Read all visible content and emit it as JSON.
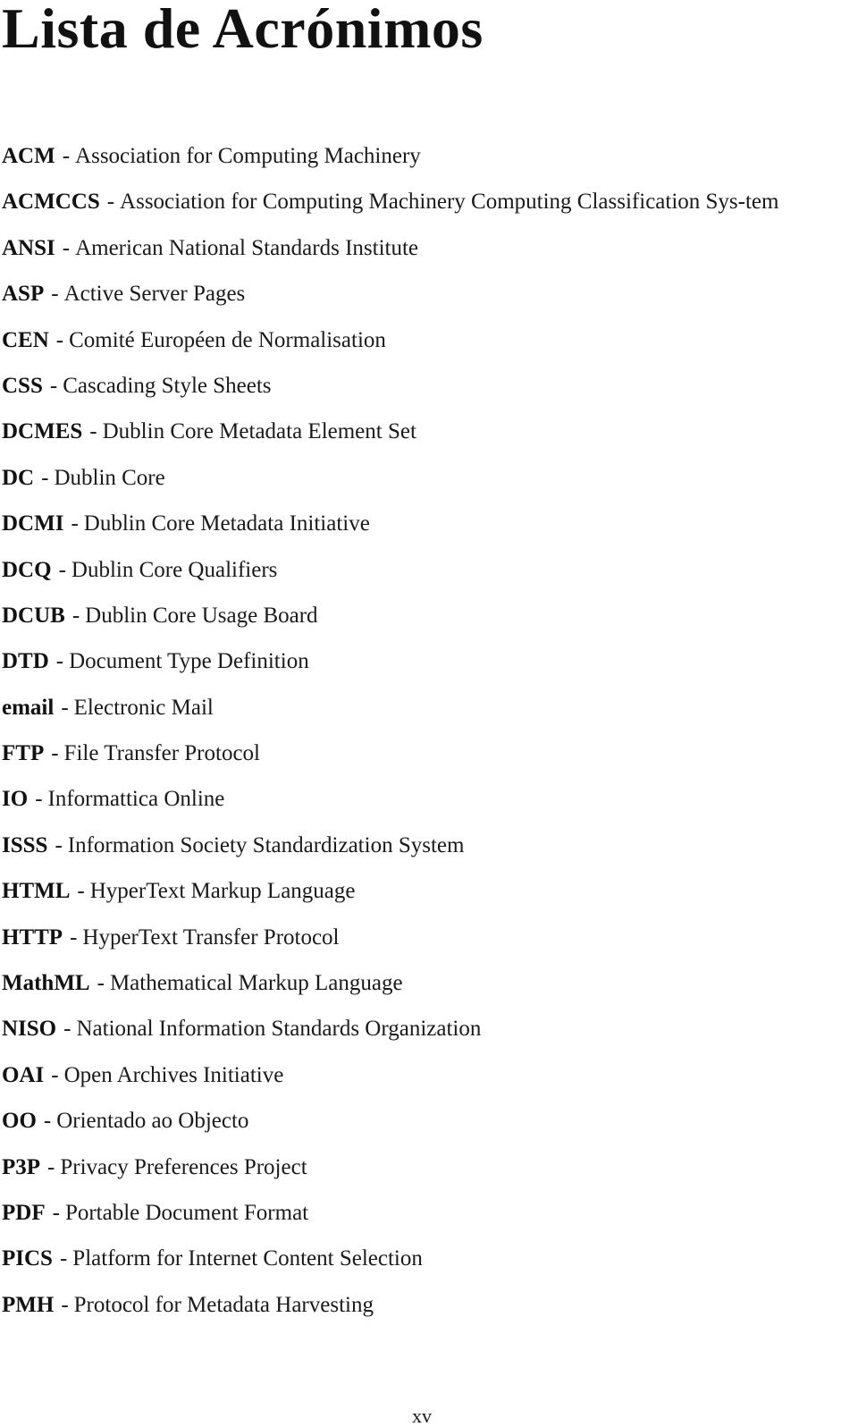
{
  "document": {
    "title": "Lista de Acrónimos",
    "separator": "-",
    "acronyms": [
      {
        "term": "ACM",
        "definition": "Association for Computing Machinery"
      },
      {
        "term": "ACMCCS",
        "definition": "Association for Computing Machinery Computing Classification Sys-tem"
      },
      {
        "term": "ANSI",
        "definition": "American National Standards Institute"
      },
      {
        "term": "ASP",
        "definition": "Active Server Pages"
      },
      {
        "term": "CEN",
        "definition": "Comité Européen de Normalisation"
      },
      {
        "term": "CSS",
        "definition": "Cascading Style Sheets"
      },
      {
        "term": "DCMES",
        "definition": "Dublin Core Metadata Element Set"
      },
      {
        "term": "DC",
        "definition": "Dublin Core"
      },
      {
        "term": "DCMI",
        "definition": "Dublin Core Metadata Initiative"
      },
      {
        "term": "DCQ",
        "definition": "Dublin Core Qualifiers"
      },
      {
        "term": "DCUB",
        "definition": "Dublin Core Usage Board"
      },
      {
        "term": "DTD",
        "definition": "Document Type Definition"
      },
      {
        "term": "email",
        "definition": "Electronic Mail"
      },
      {
        "term": "FTP",
        "definition": "File Transfer Protocol"
      },
      {
        "term": "IO",
        "definition": "Informattica Online"
      },
      {
        "term": "ISSS",
        "definition": "Information Society Standardization System"
      },
      {
        "term": "HTML",
        "definition": "HyperText Markup Language"
      },
      {
        "term": "HTTP",
        "definition": "HyperText Transfer Protocol"
      },
      {
        "term": "MathML",
        "definition": "Mathematical Markup Language"
      },
      {
        "term": "NISO",
        "definition": "National Information Standards Organization"
      },
      {
        "term": "OAI",
        "definition": "Open Archives Initiative"
      },
      {
        "term": "OO",
        "definition": "Orientado ao Objecto"
      },
      {
        "term": "P3P",
        "definition": "Privacy Preferences Project"
      },
      {
        "term": "PDF",
        "definition": "Portable Document Format"
      },
      {
        "term": "PICS",
        "definition": "Platform for Internet Content Selection"
      },
      {
        "term": "PMH",
        "definition": "Protocol for Metadata Harvesting"
      }
    ],
    "page_number": "xv"
  }
}
